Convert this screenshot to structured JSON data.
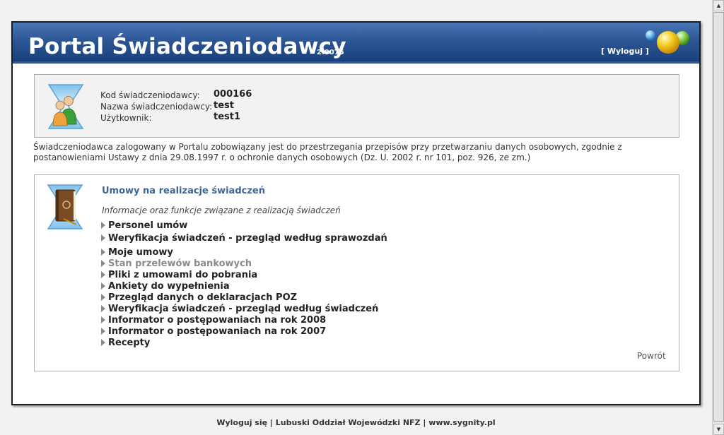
{
  "header": {
    "title": "Portal Świadczeniodawcy",
    "version": "2.0075",
    "logout": "[ Wyloguj ]"
  },
  "provider_info": {
    "code_label": "Kod świadczeniodawcy:",
    "code_value": "000166",
    "name_label": "Nazwa świadczeniodawcy:",
    "name_value": "test",
    "user_label": "Użytkownik:",
    "user_value": "test1"
  },
  "notice": "Świadczeniodawca zalogowany w Portalu zobowiązany jest do przestrzegania przepisów przy przetwarzaniu danych osobowych, zgodnie z postanowieniami Ustawy z dnia 29.08.1997 r. o ochronie danych osobowych (Dz. U. 2002 r. nr 101, poz. 926, ze zm.)",
  "contracts": {
    "title": "Umowy na realizacje świadczeń",
    "subtitle": "Informacje oraz funkcje związane z realizacją świadczeń",
    "items": [
      {
        "label": "Personel umów"
      },
      {
        "label": "Weryfikacja świadczeń - przegląd według sprawozdań"
      },
      {
        "label": "Moje umowy"
      },
      {
        "label": "Stan przelewów bankowych"
      },
      {
        "label": "Pliki z umowami do pobrania"
      },
      {
        "label": "Ankiety do wypełnienia"
      },
      {
        "label": "Przegląd danych o deklaracjach POZ"
      },
      {
        "label": "Weryfikacja świadczeń - przegląd według świadczeń"
      },
      {
        "label": "Informator o postępowaniach na rok 2008"
      },
      {
        "label": "Informator o postępowaniach na rok 2007"
      },
      {
        "label": "Recepty"
      }
    ],
    "back": "Powrót"
  },
  "footer": {
    "logout": "Wyloguj się",
    "sep1": " | ",
    "department": "Lubuski Oddział Wojewódzki NFZ",
    "sep2": " | ",
    "website": "www.sygnity.pl"
  },
  "icons": {
    "users": "users-icon",
    "book": "book-icon",
    "balls": "decorative-balls-icon"
  },
  "colors": {
    "header_blue": "#2c5594",
    "section_title": "#3d6698",
    "disabled_item": "#8a8a8a"
  }
}
